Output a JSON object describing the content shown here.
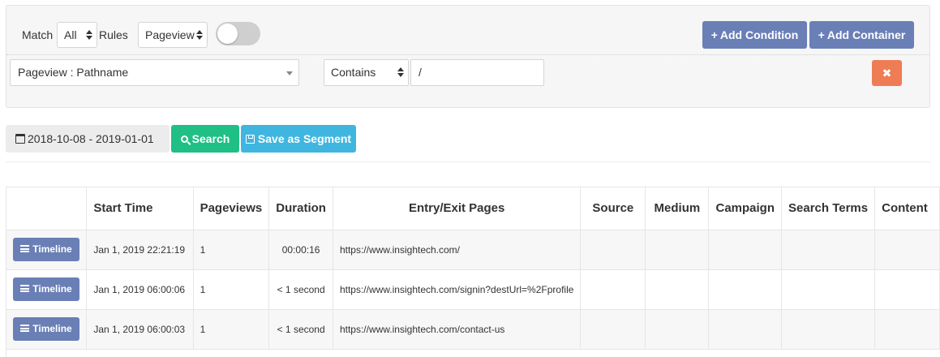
{
  "filter": {
    "match_label": "Match",
    "match_value": "All",
    "rules_label": "Rules",
    "type_value": "Pageview",
    "add_condition_label": "Add Condition",
    "add_container_label": "Add Container",
    "condition": {
      "field": "Pageview : Pathname",
      "operator": "Contains",
      "value": "/",
      "remove_icon": "✖"
    }
  },
  "toolbar": {
    "date_range": "2018-10-08 - 2019-01-01",
    "search_label": "Search",
    "save_segment_label": "Save as Segment"
  },
  "table": {
    "headers": [
      "",
      "Start Time",
      "Pageviews",
      "Duration",
      "Entry/Exit Pages",
      "Source",
      "Medium",
      "Campaign",
      "Search Terms",
      "Content"
    ],
    "timeline_label": "Timeline",
    "rows": [
      {
        "start": "Jan 1, 2019 22:21:19",
        "pageviews": "1",
        "duration": "00:00:16",
        "pages": "https://www.insightech.com/",
        "source": "",
        "medium": "",
        "campaign": "",
        "search_terms": "",
        "content": ""
      },
      {
        "start": "Jan 1, 2019 06:00:06",
        "pageviews": "1",
        "duration": "< 1 second",
        "pages": "https://www.insightech.com/signin?destUrl=%2Fprofile",
        "source": "",
        "medium": "",
        "campaign": "",
        "search_terms": "",
        "content": ""
      },
      {
        "start": "Jan 1, 2019 06:00:03",
        "pageviews": "1",
        "duration": "< 1 second",
        "pages": "https://www.insightech.com/contact-us",
        "source": "",
        "medium": "",
        "campaign": "",
        "search_terms": "",
        "content": ""
      }
    ]
  },
  "colors": {
    "primary_button": "#6a7fb6",
    "search_button": "#1fbf86",
    "save_button": "#3fb6df",
    "remove_button": "#ee7d55"
  }
}
